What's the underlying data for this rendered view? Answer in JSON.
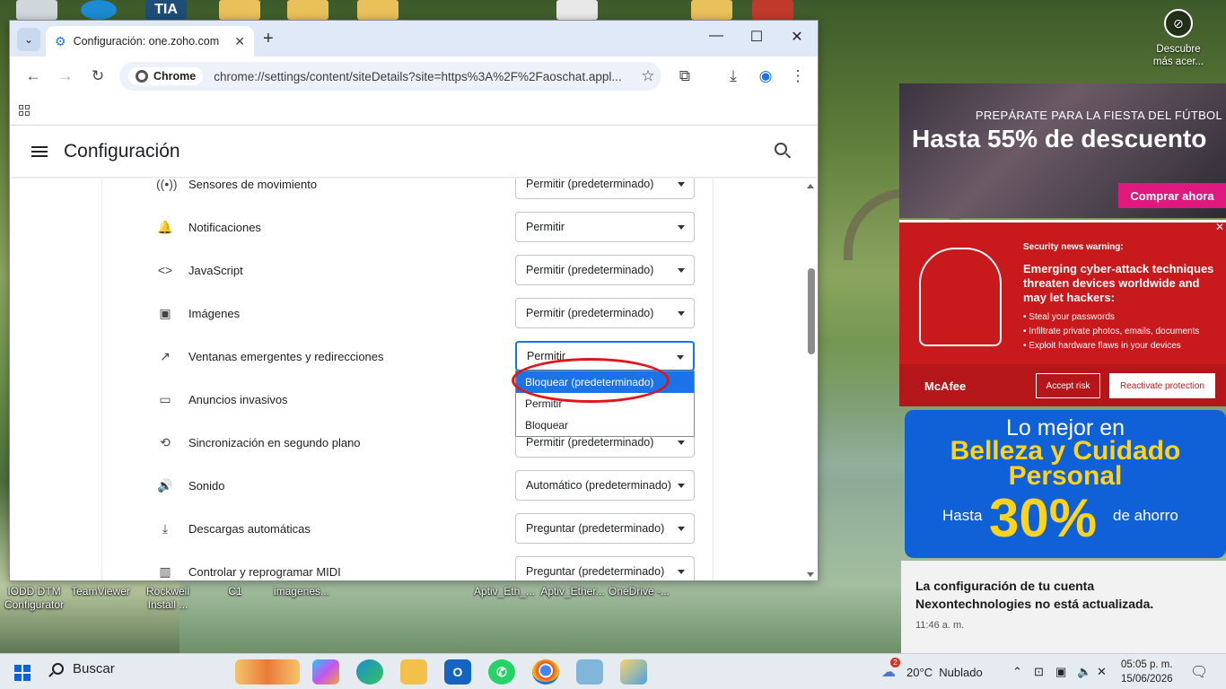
{
  "desktop": {
    "bottom_icons": [
      "IODD DTM Configurator",
      "TeamViewer",
      "Rockwell Install ...",
      "C1",
      "imagenes...",
      "Aptiv_Eth_...",
      "Aptiv_Ether...",
      "OneDrive -..."
    ],
    "top_partial_label": "TIA"
  },
  "chrome": {
    "tab_search_icon": "chevron-down-icon",
    "tab_title": "Configuración: one.zoho.com",
    "new_tab_label": "+",
    "window_controls": {
      "minimize": "—",
      "maximize": "☐",
      "close": "✕"
    },
    "chip_label": "Chrome",
    "url": "chrome://settings/content/siteDetails?site=https%3A%2F%2Faoschat.appl...",
    "accent_color": "#1a73e8"
  },
  "settings": {
    "title": "Configuración",
    "rows": [
      {
        "icon": "((•))",
        "label": "Sensores de movimiento",
        "value": "Permitir (predeterminado)"
      },
      {
        "icon": "🔔",
        "label": "Notificaciones",
        "value": "Permitir"
      },
      {
        "icon": "<>",
        "label": "JavaScript",
        "value": "Permitir (predeterminado)"
      },
      {
        "icon": "▣",
        "label": "Imágenes",
        "value": "Permitir (predeterminado)"
      },
      {
        "icon": "↗",
        "label": "Ventanas emergentes y redirecciones",
        "value": "Permitir"
      },
      {
        "icon": "▭",
        "label": "Anuncios invasivos",
        "value": ""
      },
      {
        "icon": "⟲",
        "label": "Sincronización en segundo plano",
        "value": "Permitir (predeterminado)"
      },
      {
        "icon": "🔊",
        "label": "Sonido",
        "value": "Automático (predeterminado)"
      },
      {
        "icon": "⤓",
        "label": "Descargas automáticas",
        "value": "Preguntar (predeterminado)"
      },
      {
        "icon": "▥",
        "label": "Controlar y reprogramar MIDI",
        "value": "Preguntar (predeterminado)"
      }
    ],
    "dropdown_options": [
      "Bloquear (predeterminado)",
      "Permitir",
      "Bloquear"
    ]
  },
  "widgets": {
    "discover": "Descubre más acer...",
    "ad1": {
      "small": "PREPÁRATE PARA LA FIESTA DEL FÚTBOL",
      "big": "Hasta 55% de descuento",
      "button": "Comprar ahora"
    },
    "ad2": {
      "warning": "Security news warning:",
      "headline": "Emerging cyber-attack techniques threaten devices worldwide and may let hackers:",
      "bullets": [
        "Steal your passwords",
        "Infiltrate private photos, emails, documents",
        "Exploit hardware flaws in your devices"
      ],
      "brand": "McAfee",
      "accept": "Accept risk",
      "reactivate": "Reactivate protection"
    },
    "ad3": {
      "line1": "Lo mejor en",
      "line2": "Belleza y Cuidado Personal",
      "hasta": "Hasta",
      "pct": "30%",
      "ahorro": "de ahorro"
    },
    "notification": {
      "text": "La configuración de tu cuenta Nexontechnologies no está actualizada.",
      "time": "11:46 a. m."
    }
  },
  "taskbar": {
    "search": "Buscar",
    "weather_badge": "2",
    "weather": "20°C  Nublado",
    "time": "05:05 p. m.",
    "date": "15/06/2026"
  }
}
